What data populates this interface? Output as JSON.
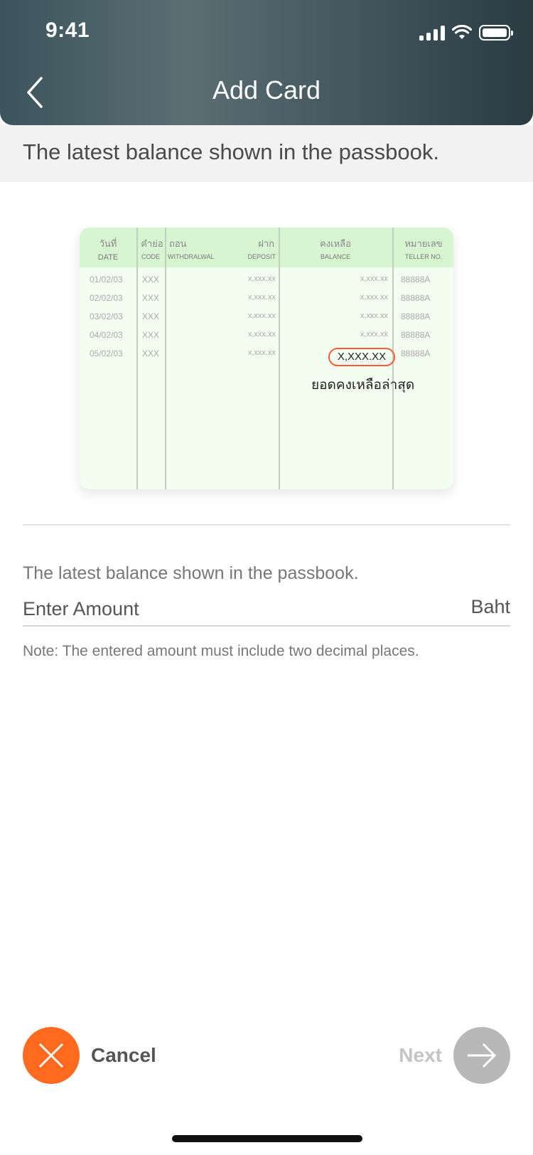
{
  "status_bar": {
    "time": "9:41"
  },
  "header": {
    "title": "Add Card"
  },
  "subtitle": "The latest balance shown in the passbook.",
  "passbook": {
    "columns": [
      {
        "thai": "วันที่",
        "en": "DATE"
      },
      {
        "thai": "คำย่อ",
        "en": "CODE"
      },
      {
        "thai": "ถอน",
        "en": "WITHDRALWAL"
      },
      {
        "thai": "ฝาก",
        "en": "DEPOSIT"
      },
      {
        "thai": "คงเหลือ",
        "en": "BALANCE"
      },
      {
        "thai": "หมายเลข",
        "en": "TELLER NO."
      }
    ],
    "rows": [
      {
        "date": "01/02/03",
        "code": "XXX",
        "deposit": "x,xxx.xx",
        "balance": "x,xxx.xx",
        "teller": "88888A"
      },
      {
        "date": "02/02/03",
        "code": "XXX",
        "deposit": "x,xxx.xx",
        "balance": "x,xxx.xx",
        "teller": "88888A"
      },
      {
        "date": "03/02/03",
        "code": "XXX",
        "deposit": "x,xxx.xx",
        "balance": "x,xxx.xx",
        "teller": "88888A"
      },
      {
        "date": "04/02/03",
        "code": "XXX",
        "deposit": "x,xxx.xx",
        "balance": "x,xxx.xx",
        "teller": "88888A"
      },
      {
        "date": "05/02/03",
        "code": "XXX",
        "deposit": "x,xxx.xx",
        "balance": "X,XXX.XX",
        "teller": "88888A"
      }
    ],
    "latest_balance_label": "ยอดคงเหลือล่าสุด"
  },
  "form": {
    "label": "The latest balance shown in the passbook.",
    "placeholder": "Enter Amount",
    "unit": "Baht",
    "note": "Note: The entered amount must include two decimal places."
  },
  "actions": {
    "cancel_label": "Cancel",
    "next_label": "Next"
  },
  "colors": {
    "header_gradient_start": "#3c545c",
    "header_gradient_end": "#2a3b42",
    "cancel_orange": "#ff6a1f",
    "next_disabled_gray": "#b8b8b8",
    "highlight_red": "#ff5a36",
    "passbook_green": "#d8f5d2"
  },
  "icons": {
    "back": "chevron-left-icon",
    "cancel": "close-icon",
    "next": "arrow-right-icon"
  }
}
